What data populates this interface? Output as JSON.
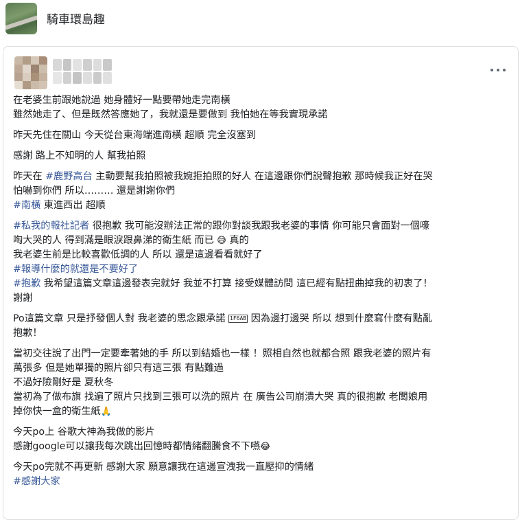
{
  "group": {
    "name": "騎車環島趣",
    "avatar_icon": "landscape-photo"
  },
  "post": {
    "more_icon": "more-options",
    "paragraphs": [
      {
        "lines": [
          [
            {
              "t": "在老婆生前跟她說過  她身體好一點要帶她走完南橫"
            }
          ],
          [
            {
              "t": "雖然她走了、但是既然答應她了，我就還是要做到  我怕她在等我實現承諾"
            }
          ]
        ]
      },
      {
        "lines": [
          [
            {
              "t": "昨天先住在關山 今天從台東海端進南橫 超順 完全沒塞到"
            }
          ]
        ]
      },
      {
        "lines": [
          [
            {
              "t": "感謝 路上不知明的人 幫我拍照"
            }
          ]
        ]
      },
      {
        "lines": [
          [
            {
              "t": "昨天在 "
            },
            {
              "t": "#鹿野高台",
              "tag": true
            },
            {
              "t": " 主動要幫我拍照被我婉拒拍照的好人 在這邊跟你們說聲抱歉 那時候我正好在哭"
            }
          ],
          [
            {
              "t": "怕嚇到你們 所以………  還是謝謝你們"
            }
          ],
          [
            {
              "t": "#南橫",
              "tag": true
            },
            {
              "t": " 東進西出 超順"
            }
          ]
        ]
      },
      {
        "lines": [
          [
            {
              "t": "#私我的報社記者",
              "tag": true
            },
            {
              "t": " 很抱歉 我可能沒辦法正常的跟你對談我跟我老婆的事情  你可能只會面對一個嚎"
            }
          ],
          [
            {
              "t": "啕大哭的人 得到滿是眼淚跟鼻涕的衛生紙 而已 "
            },
            {
              "t": "😅",
              "emoji": true
            },
            {
              "t": "  真的"
            }
          ],
          [
            {
              "t": "我老婆生前是比較喜歡低調的人 所以 還是這邊看看就好了"
            }
          ],
          [
            {
              "t": "#報導什麼的就還是不要好了",
              "tag": true
            }
          ],
          [
            {
              "t": "#抱歉",
              "tag": true
            },
            {
              "t": " 我希望這篇文章這邊發表完就好  我並不打算 接受媒體訪問 這已經有點扭曲掉我的初衷了！"
            }
          ],
          [
            {
              "t": "謝謝"
            }
          ]
        ]
      },
      {
        "lines": [
          [
            {
              "t": "Po這篇文章 只是抒發個人對 我老婆的思念跟承諾 "
            },
            {
              "t": "1F6AB",
              "box": true
            },
            {
              "t": "  因為邊打邊哭 所以 想到什麼寫什麼有點亂"
            }
          ],
          [
            {
              "t": "抱歉！"
            }
          ]
        ]
      },
      {
        "lines": [
          [
            {
              "t": "當初交往說了出門一定要牽著她的手 所以到結婚也一樣 ！照相自然也就都合照  跟我老婆的照片有"
            }
          ],
          [
            {
              "t": "萬張多  但是她單獨的照片卻只有這三張 有點難過"
            }
          ],
          [
            {
              "t": "不過好險剛好是 夏秋冬"
            }
          ],
          [
            {
              "t": "當初為了做布旗 找遍了照片只找到三張可以洗的照片 在 廣告公司崩潰大哭 真的很抱歉 老闆娘用"
            }
          ],
          [
            {
              "t": "掉你快一盒的衛生紙"
            },
            {
              "t": "🙏",
              "emoji": true
            }
          ]
        ]
      },
      {
        "lines": [
          [
            {
              "t": "今天po上 谷歌大神為我做的影片"
            }
          ],
          [
            {
              "t": "感謝google可以讓我每次跳出回憶時都情緒翻騰食不下嚥"
            },
            {
              "t": "😂",
              "emoji": true
            }
          ]
        ]
      },
      {
        "lines": [
          [
            {
              "t": "今天po完就不再更新  感謝大家  願意讓我在這邊宣洩我一直壓抑的情緒"
            }
          ],
          [
            {
              "t": "#感謝大家",
              "tag": true
            }
          ]
        ]
      }
    ]
  }
}
